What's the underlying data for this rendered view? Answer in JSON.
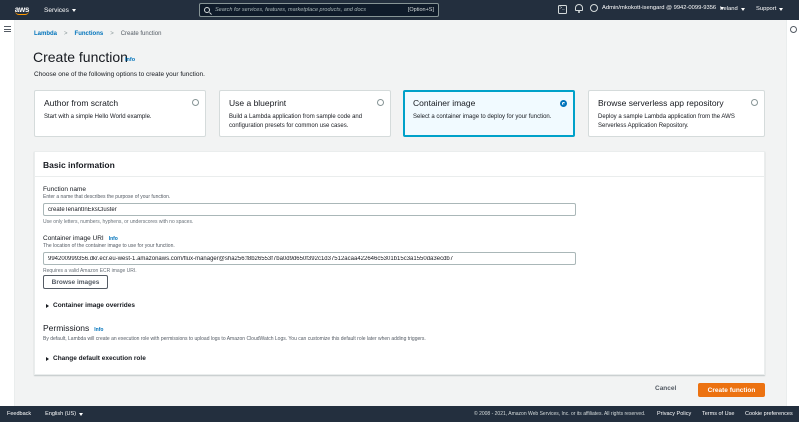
{
  "topnav": {
    "logo": "aws",
    "services_label": "Services",
    "search_placeholder": "Search for services, features, marketplace products, and docs",
    "search_shortcut": "[Option+S]",
    "account": "Admin/mkokott-isengard @ 9942-0099-9356",
    "region": "Ireland",
    "support": "Support"
  },
  "breadcrumb": {
    "items": [
      "Lambda",
      "Functions"
    ],
    "current": "Create function"
  },
  "page": {
    "title": "Create function",
    "info": "Info",
    "subtitle": "Choose one of the following options to create your function."
  },
  "options": [
    {
      "title": "Author from scratch",
      "desc": "Start with a simple Hello World example.",
      "selected": false
    },
    {
      "title": "Use a blueprint",
      "desc": "Build a Lambda application from sample code and configuration presets for common use cases.",
      "selected": false
    },
    {
      "title": "Container image",
      "desc": "Select a container image to deploy for your function.",
      "selected": true
    },
    {
      "title": "Browse serverless app repository",
      "desc": "Deploy a sample Lambda application from the AWS Serverless Application Repository.",
      "selected": false
    }
  ],
  "basic": {
    "header": "Basic information",
    "function_name": {
      "label": "Function name",
      "desc": "Enter a name that describes the purpose of your function.",
      "value": "createTenantInEksCluster",
      "hint": "Use only letters, numbers, hyphens, or underscores with no spaces."
    },
    "image_uri": {
      "label": "Container image URI",
      "info": "Info",
      "desc": "The location of the container image to use for your function.",
      "value": "994200999356.dkr.ecr.eu-west-1.amazonaws.com/flux-manager@sha256:f8b26553f7ba0d9d650f392c1d37512acaa422646c5301b15c3a1550da3ecdb7",
      "hint": "Requires a valid Amazon ECR image URI.",
      "browse_label": "Browse images"
    },
    "overrides_label": "Container image overrides",
    "permissions": {
      "title": "Permissions",
      "info": "Info",
      "desc": "By default, Lambda will create an execution role with permissions to upload logs to Amazon CloudWatch Logs. You can customize this default role later when adding triggers.",
      "change_role_label": "Change default execution role"
    }
  },
  "actions": {
    "cancel": "Cancel",
    "create": "Create function"
  },
  "footer": {
    "feedback": "Feedback",
    "language": "English (US)",
    "copyright": "© 2008 - 2021, Amazon Web Services, Inc. or its affiliates. All rights reserved.",
    "privacy": "Privacy Policy",
    "terms": "Terms of Use",
    "cookies": "Cookie preferences"
  },
  "colors": {
    "nav_bg": "#232f3e",
    "accent_orange": "#ec7211",
    "link_blue": "#0073bb",
    "selected_border": "#00a1c9"
  }
}
